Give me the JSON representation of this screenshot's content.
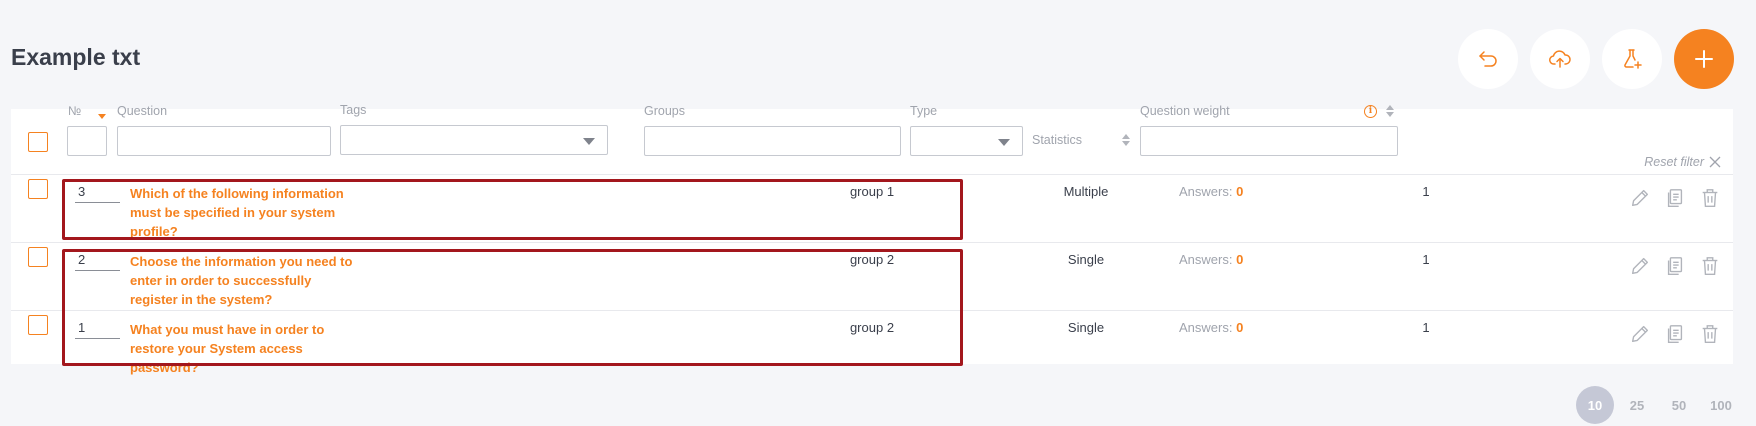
{
  "page": {
    "title": "Example txt"
  },
  "toolbar": {
    "buttons": [
      {
        "icon": "undo-arrow-icon"
      },
      {
        "icon": "cloud-upload-icon"
      },
      {
        "icon": "flask-add-icon"
      },
      {
        "icon": "plus-icon"
      }
    ],
    "accent_color": "#f58220"
  },
  "table": {
    "headers": {
      "number": "№",
      "question": "Question",
      "tags": "Tags",
      "groups": "Groups",
      "type": "Type",
      "statistics": "Statistics",
      "weight": "Question weight"
    },
    "filters": {
      "number": "",
      "question": "",
      "tags": "",
      "groups": "",
      "type": "",
      "weight": ""
    },
    "reset_filter_label": "Reset filter",
    "answers_label": "Answers:",
    "rows": [
      {
        "number": "3",
        "question": "Which of the following information must be specified in your system profile?",
        "group": "group 1",
        "type": "Multiple",
        "answers": "0",
        "weight": "1"
      },
      {
        "number": "2",
        "question": "Choose the information you need to enter in order to successfully register in the system?",
        "group": "group 2",
        "type": "Single",
        "answers": "0",
        "weight": "1"
      },
      {
        "number": "1",
        "question": "What you must have in order to restore your System access password?",
        "group": "group 2",
        "type": "Single",
        "answers": "0",
        "weight": "1"
      }
    ]
  },
  "pagination": {
    "sizes": [
      "10",
      "25",
      "50",
      "100"
    ],
    "selected": "10"
  }
}
